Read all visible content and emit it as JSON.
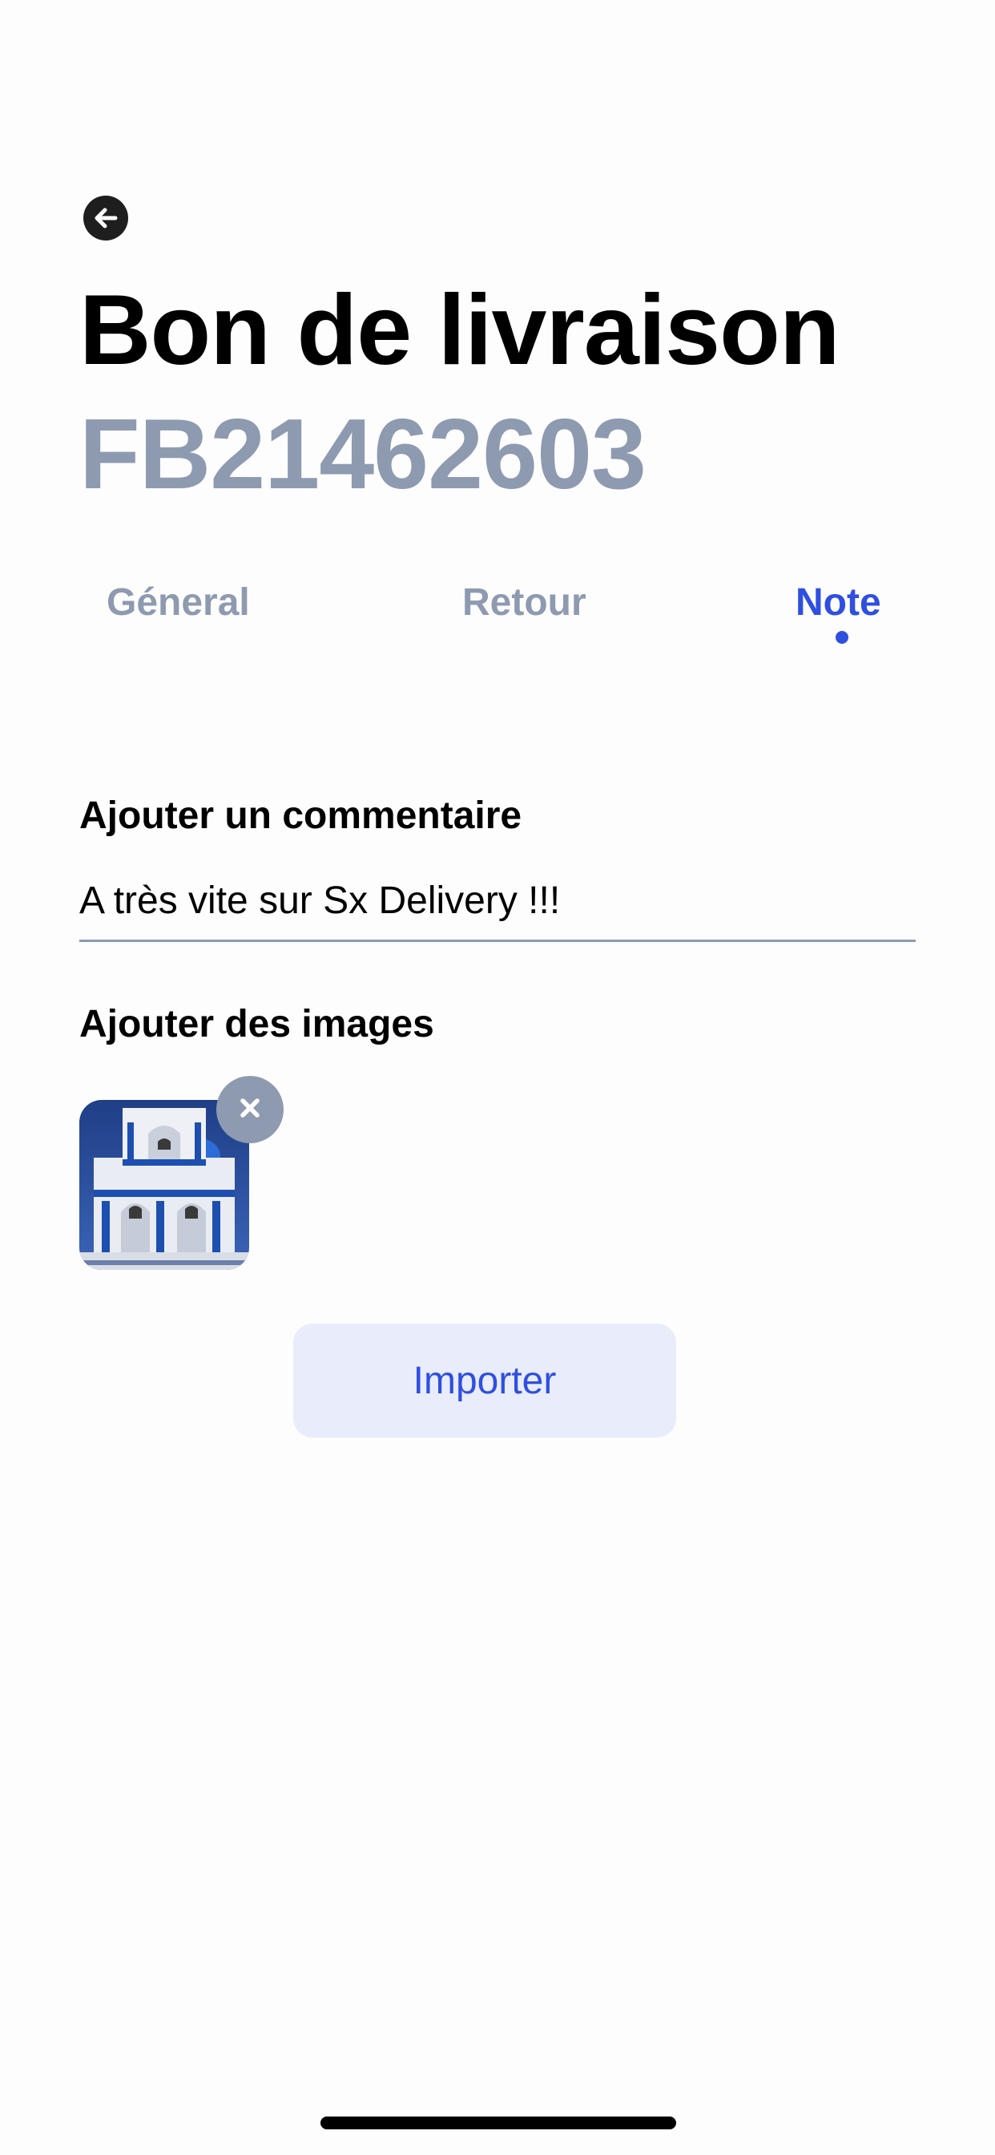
{
  "header": {
    "back_icon": "arrow-left-icon",
    "title": "Bon de livraison",
    "subtitle": "FB21462603"
  },
  "tabs": [
    {
      "label": "Géneral",
      "active": false
    },
    {
      "label": "Retour",
      "active": false
    },
    {
      "label": "Note",
      "active": true
    }
  ],
  "comment": {
    "label": "Ajouter un commentaire",
    "value": "A très vite sur Sx Delivery !!!",
    "placeholder": ""
  },
  "images": {
    "label": "Ajouter des images",
    "remove_icon": "close-icon",
    "import_label": "Importer"
  },
  "colors": {
    "accent": "#2f4fe0",
    "muted": "#8e9ab0",
    "button_bg": "#e8ecfb",
    "text": "#000000"
  }
}
